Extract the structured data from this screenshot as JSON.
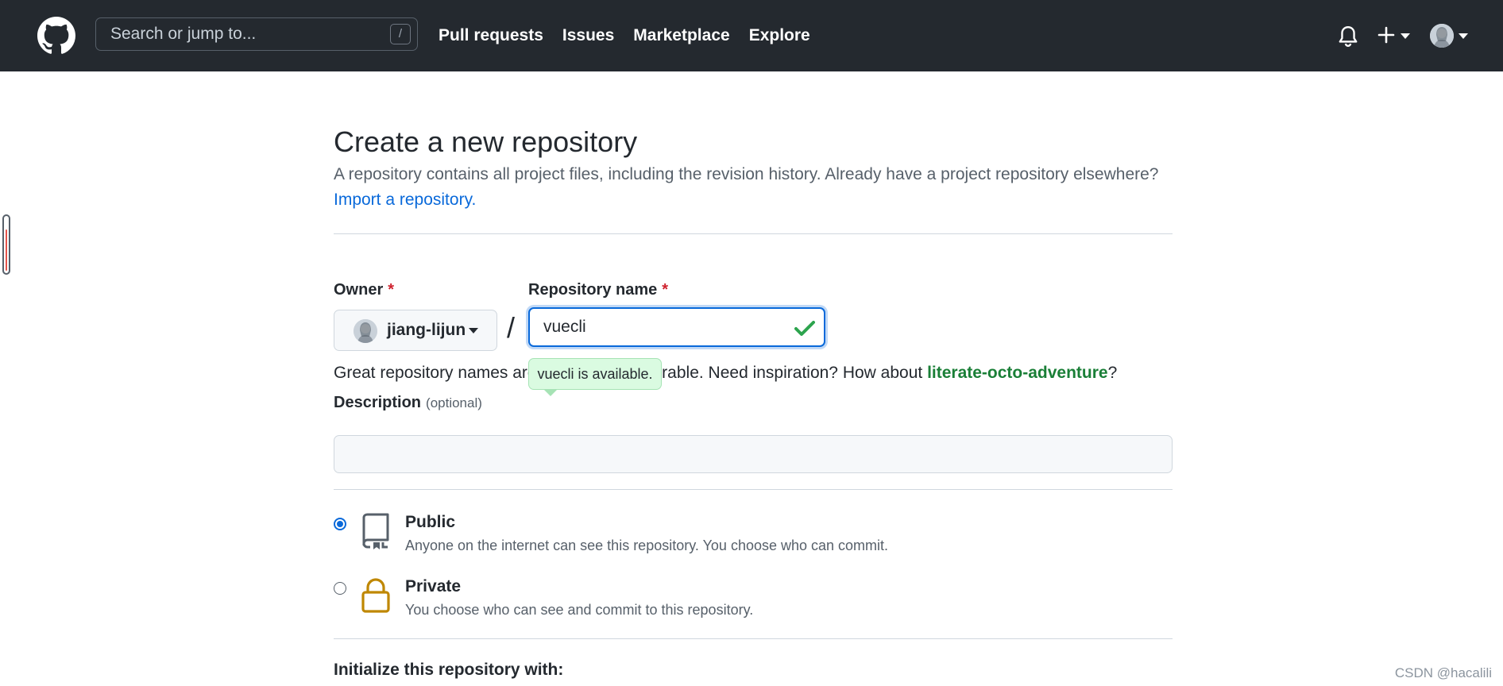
{
  "header": {
    "search": {
      "placeholder": "Search or jump to...",
      "shortcut": "/"
    },
    "nav": [
      "Pull requests",
      "Issues",
      "Marketplace",
      "Explore"
    ],
    "icons": [
      "github-logo",
      "bell-icon",
      "plus-icon",
      "user-avatar"
    ]
  },
  "page": {
    "title": "Create a new repository",
    "subtitle": "A repository contains all project files, including the revision history. Already have a project repository elsewhere?",
    "import_link": "Import a repository."
  },
  "form": {
    "owner": {
      "label": "Owner",
      "required_mark": "*",
      "value": "jiang-lijun"
    },
    "separator": "/",
    "repo_name": {
      "label": "Repository name",
      "required_mark": "*",
      "value": "vuecli",
      "valid": true
    },
    "availability_tooltip": "vuecli is available.",
    "hint": {
      "prefix": "Great repository names are short and memorable. Need inspiration? How about ",
      "suggestion": "literate-octo-adventure",
      "suffix": "?"
    },
    "description": {
      "label": "Description",
      "optional": "(optional)",
      "value": ""
    },
    "visibility": [
      {
        "title": "Public",
        "description": "Anyone on the internet can see this repository. You choose who can commit.",
        "selected": true,
        "icon": "repo-icon"
      },
      {
        "title": "Private",
        "description": "You choose who can see and commit to this repository.",
        "selected": false,
        "icon": "lock-icon"
      }
    ],
    "initialize_label": "Initialize this repository with:"
  },
  "watermark": "CSDN @hacalili",
  "colors": {
    "header_bg": "#24292f",
    "link": "#0969da",
    "success": "#1a7f37",
    "required": "#cf222e",
    "lock": "#bf8700"
  }
}
